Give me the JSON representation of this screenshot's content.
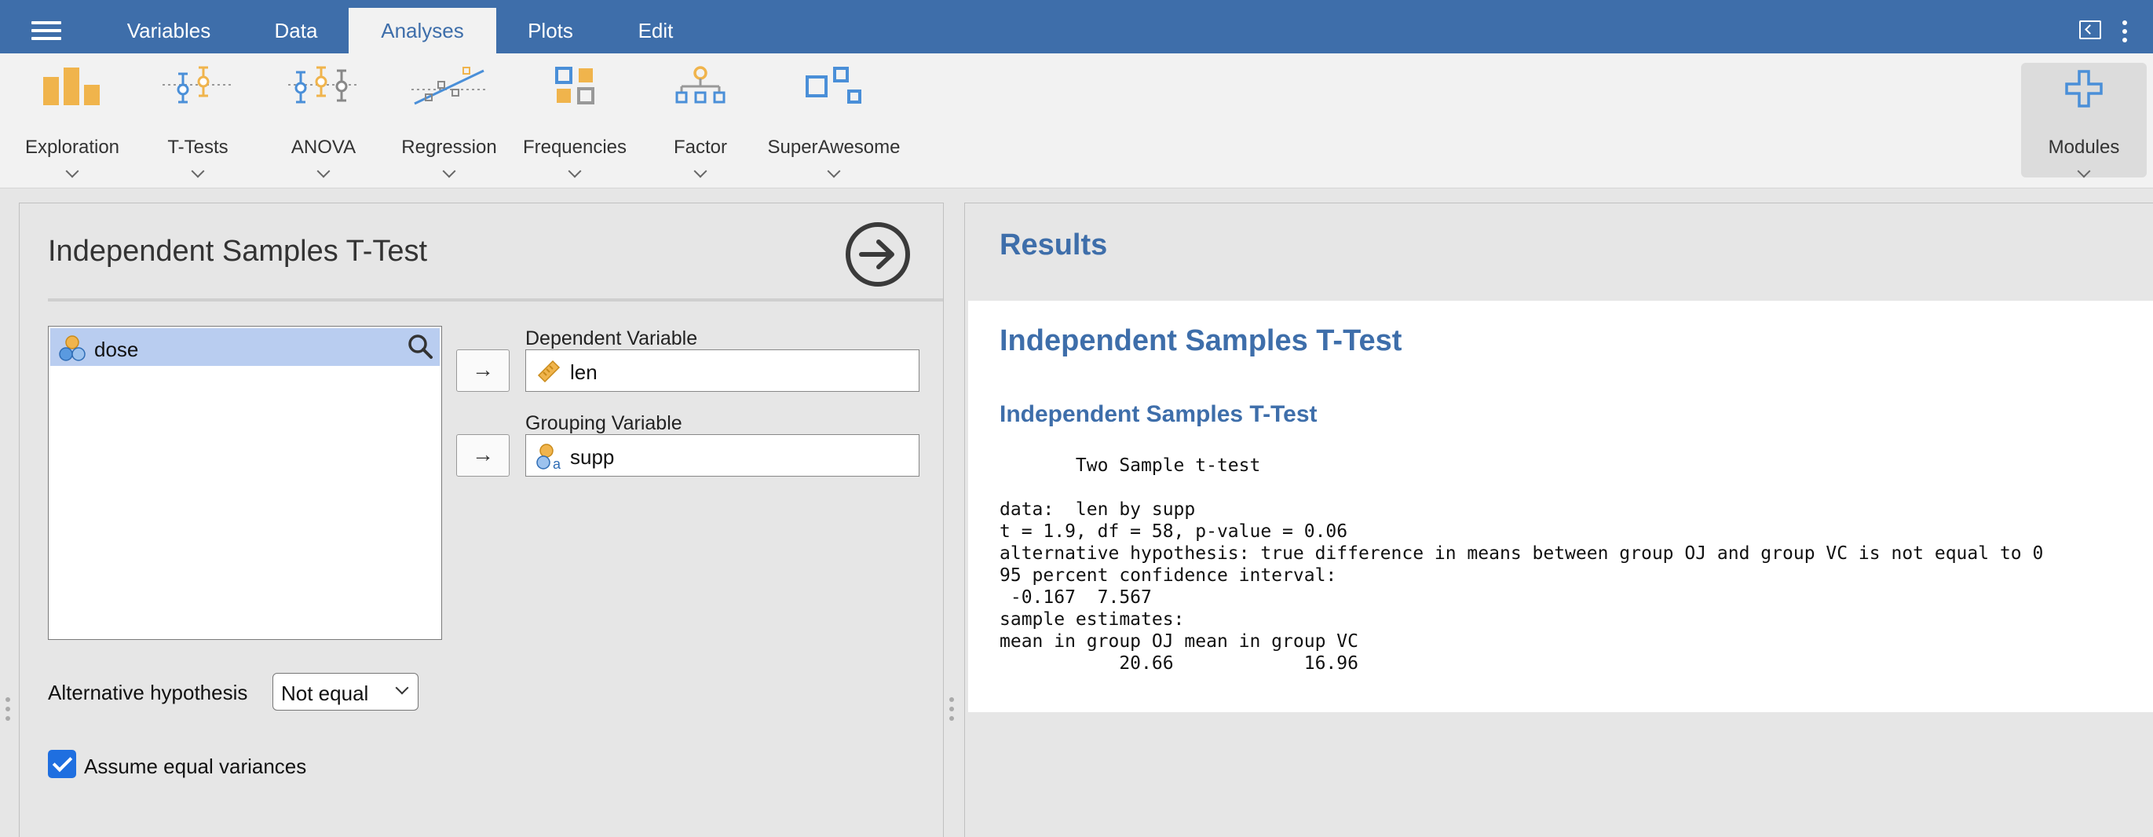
{
  "menubar": {
    "tabs": [
      {
        "label": "Variables"
      },
      {
        "label": "Data"
      },
      {
        "label": "Analyses",
        "active": true
      },
      {
        "label": "Plots"
      },
      {
        "label": "Edit"
      }
    ],
    "icons": [
      "hamburger-menu-icon",
      "window-mode-icon",
      "more-options-icon"
    ]
  },
  "ribbon": {
    "items": [
      {
        "label": "Exploration",
        "icon": "exploration-icon"
      },
      {
        "label": "T-Tests",
        "icon": "t-tests-icon"
      },
      {
        "label": "ANOVA",
        "icon": "anova-icon"
      },
      {
        "label": "Regression",
        "icon": "regression-icon"
      },
      {
        "label": "Frequencies",
        "icon": "frequencies-icon"
      },
      {
        "label": "Factor",
        "icon": "factor-icon"
      },
      {
        "label": "SuperAwesome",
        "icon": "superawesome-icon"
      }
    ],
    "modules": {
      "label": "Modules",
      "icon": "plus-icon"
    }
  },
  "options": {
    "title": "Independent Samples T-Test",
    "variables": [
      {
        "name": "dose",
        "type": "nominal"
      }
    ],
    "dependent": {
      "label": "Dependent Variable",
      "value": "len",
      "type": "continuous"
    },
    "grouping": {
      "label": "Grouping Variable",
      "value": "supp",
      "type": "nominal-text"
    },
    "arrow": "→",
    "alternative": {
      "label": "Alternative hypothesis",
      "value": "Not equal"
    },
    "equal_var": {
      "label": "Assume equal variances",
      "checked": true
    }
  },
  "results": {
    "title": "Results",
    "heading": "Independent Samples T-Test",
    "subheading": "Independent Samples T-Test",
    "output": "       Two Sample t-test\n\ndata:  len by supp\nt = 1.9, df = 58, p-value = 0.06\nalternative hypothesis: true difference in means between group OJ and group VC is not equal to 0\n95 percent confidence interval:\n -0.167  7.567\nsample estimates:\nmean in group OJ mean in group VC\n           20.66            16.96"
  },
  "colors": {
    "brand": "#3e6eaa",
    "ribbon_orange": "#f0b44c",
    "ribbon_blue": "#4a8fd8",
    "selection": "#b9cdf0",
    "checkbox": "#1f6fe0"
  }
}
